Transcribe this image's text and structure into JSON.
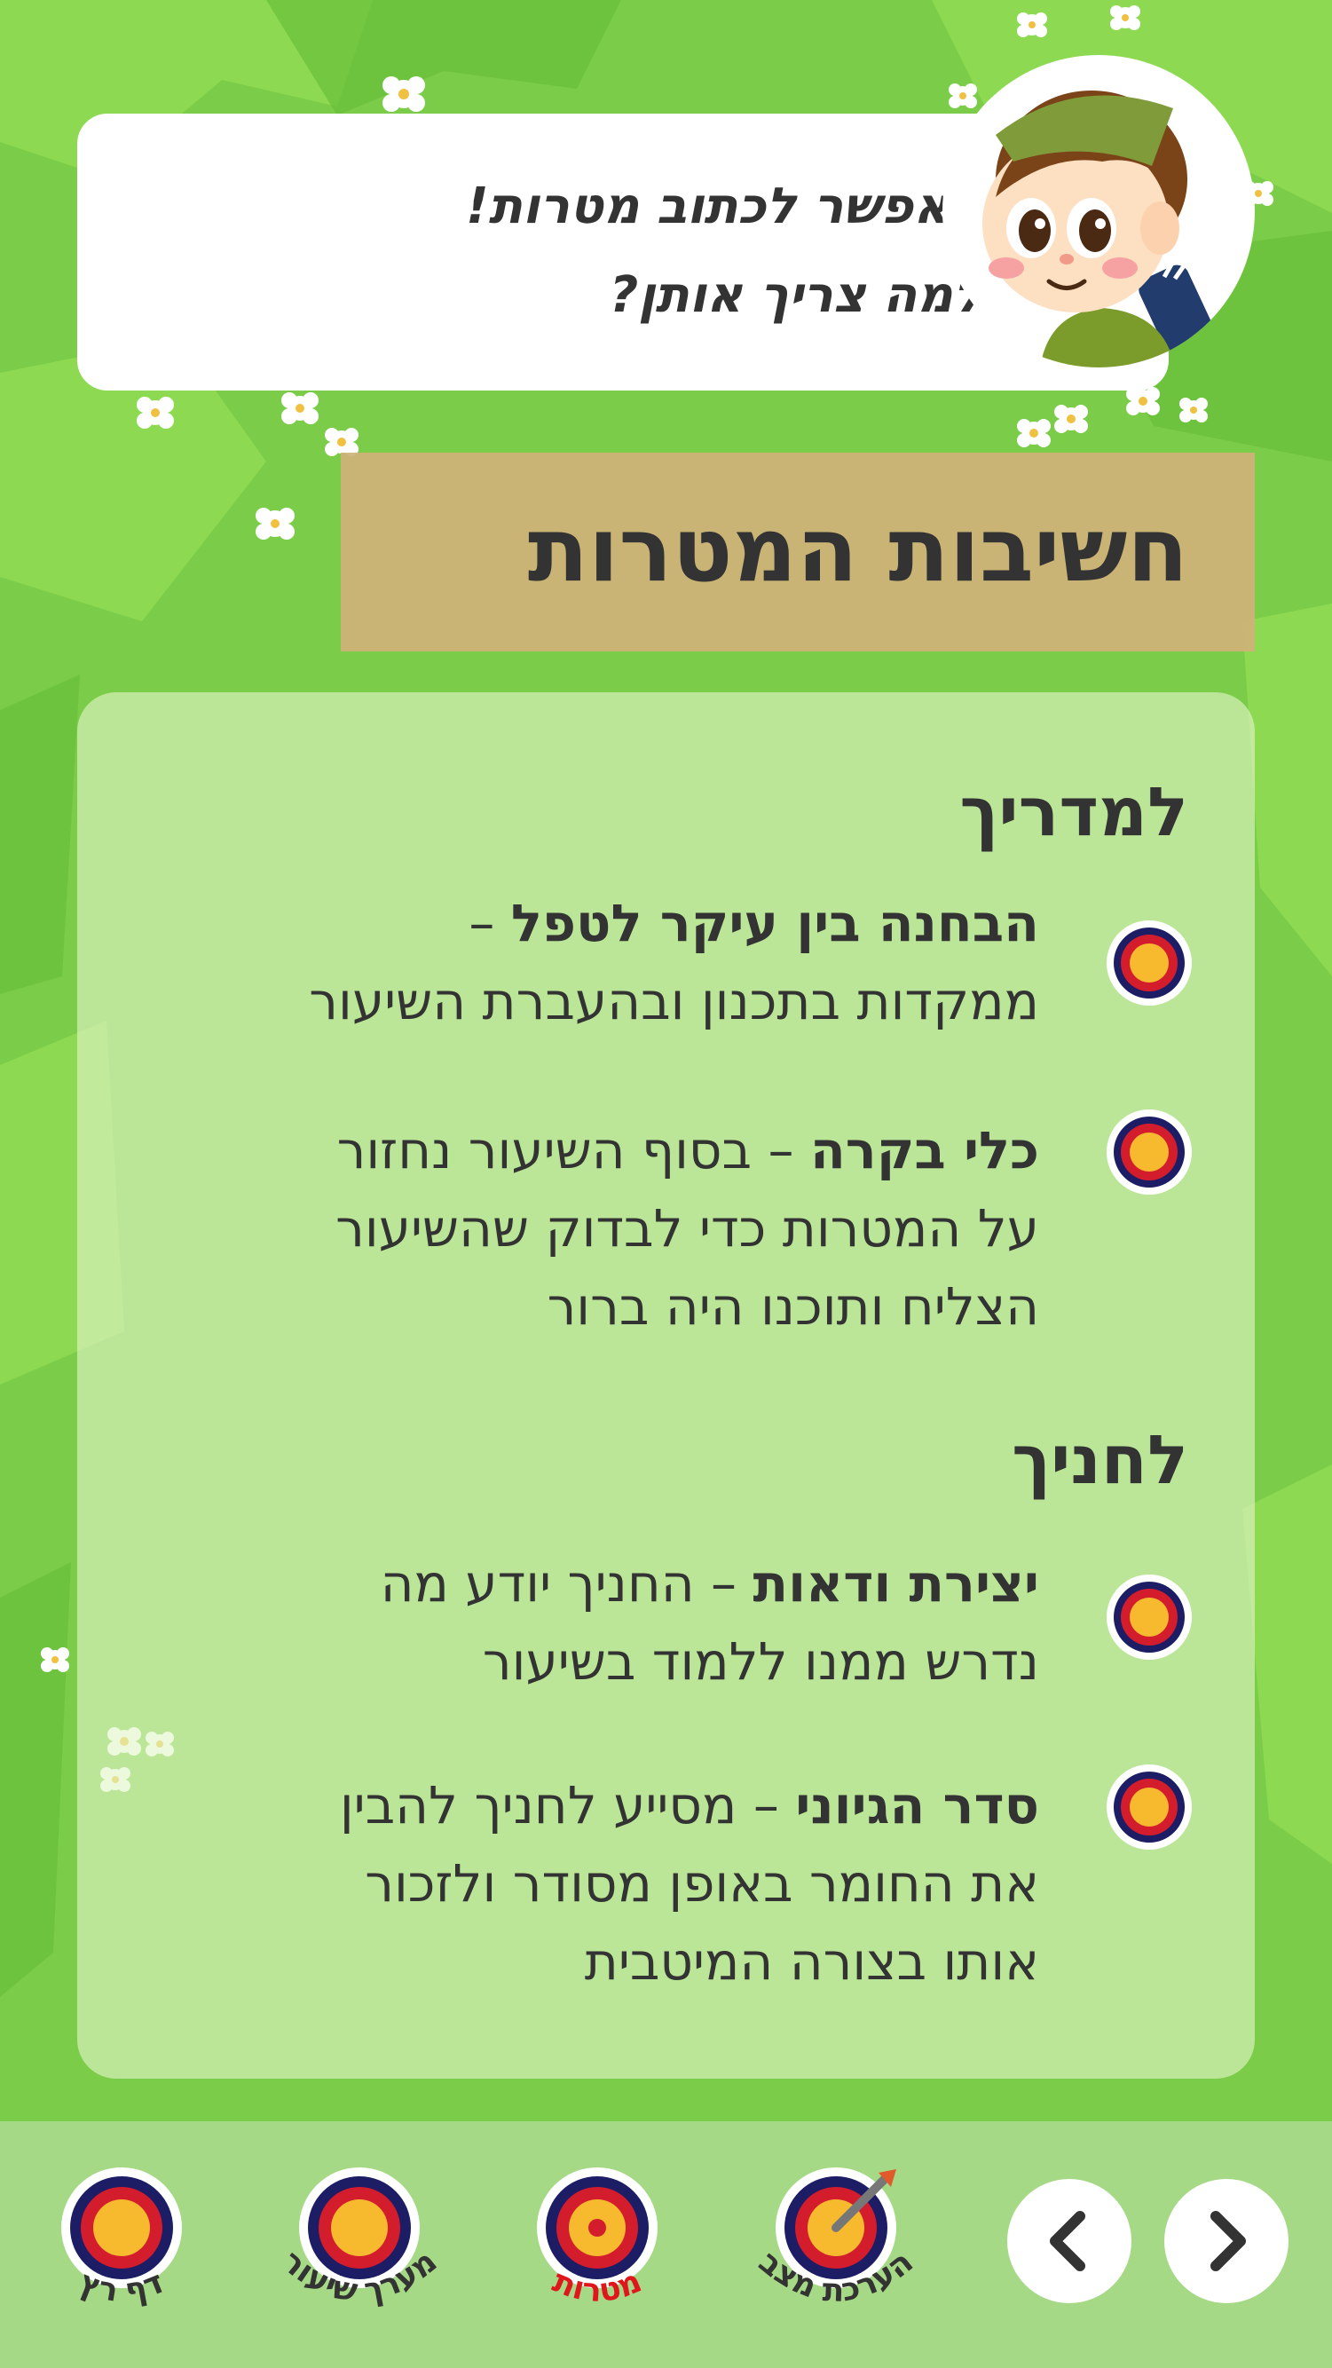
{
  "speech": {
    "line1": "עכשיו אפשר לכתוב מטרות!",
    "line2": "אבל למה צריך אותן?"
  },
  "title": "חשיבות המטרות",
  "sections": [
    {
      "heading": "למדריך",
      "items": [
        {
          "bold": "הבחנה בין עיקר לטפל",
          "rest": " – ",
          "line2": "ממקדות בתכנון ובהעברת השיעור"
        },
        {
          "bold": "כלי בקרה",
          "rest": " – בסוף השיעור נחזור",
          "line2": "על המטרות כדי לבדוק שהשיעור",
          "line3": "הצליח ותוכנו היה ברור"
        }
      ]
    },
    {
      "heading": "לחניך",
      "items": [
        {
          "bold": "יצירת ודאות",
          "rest": " – החניך יודע מה",
          "line2": "נדרש ממנו ללמוד בשיעור"
        },
        {
          "bold": "סדר הגיוני",
          "rest": " – מסייע לחניך להבין",
          "line2": "את החומר באופן מסודר ולזכור",
          "line3": "אותו בצורה המיטבית"
        }
      ]
    }
  ],
  "nav": {
    "items": [
      {
        "label": "הערכת מצב",
        "active": false
      },
      {
        "label": "מטרות",
        "active": true
      },
      {
        "label": "מערך שיעור",
        "active": false
      },
      {
        "label": "דף רץ",
        "active": false
      }
    ],
    "prev_icon": "chevron-left-icon",
    "next_icon": "chevron-right-icon"
  },
  "colors": {
    "background": "#7ccd4a",
    "title_band": "#cfb27a",
    "active_nav": "#e0161d",
    "target_ring_outer": "#1c1d64",
    "target_ring_red": "#d31c2c",
    "target_center": "#f7b92e"
  }
}
